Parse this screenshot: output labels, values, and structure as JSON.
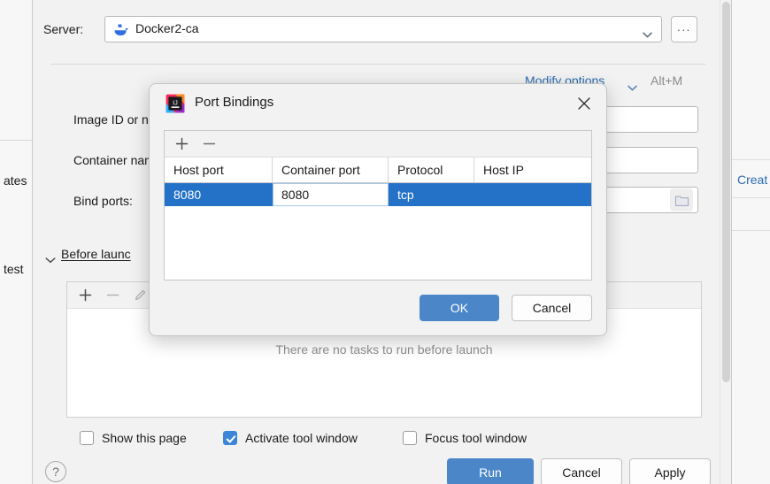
{
  "background": {
    "server_row": {
      "label": "Server:",
      "value": "Docker2-ca",
      "icon": "docker-whale-icon",
      "dropdown_icon": "chevron-down-icon",
      "more_button_label": "..."
    },
    "modify_options": {
      "link_label": "Modify options",
      "chevron_icon": "chevron-down-icon",
      "shortcut": "Alt+M"
    },
    "fields": [
      {
        "label": "Image ID or na",
        "name": "image-id-or-name"
      },
      {
        "label": "Container nam",
        "name": "container-name"
      },
      {
        "label": "Bind ports:",
        "name": "bind-ports"
      }
    ],
    "browse_icon": "folder-icon",
    "before_launch": {
      "expander_icon": "chevron-down-icon",
      "label": "Before launc",
      "toolbar": {
        "add_icon": "plus-icon",
        "remove_icon": "minus-icon",
        "edit_icon": "pencil-icon"
      },
      "empty_text": "There are no tasks to run before launch"
    },
    "checkboxes": [
      {
        "label": "Show this page",
        "checked": false,
        "name": "show-this-page"
      },
      {
        "label": "Activate tool window",
        "checked": true,
        "name": "activate-tool-window"
      },
      {
        "label": "Focus tool window",
        "checked": false,
        "name": "focus-tool-window"
      }
    ],
    "buttons": {
      "help_label": "?",
      "run_label": "Run",
      "cancel_label": "Cancel",
      "apply_label": "Apply"
    },
    "edge_left": {
      "items": [
        "ates",
        "test"
      ]
    },
    "edge_right": {
      "items": [
        "Creat"
      ]
    }
  },
  "dialog": {
    "title": "Port Bindings",
    "app_icon": "intellij-idea-icon",
    "close_icon": "close-icon",
    "toolbar": {
      "add_icon": "plus-icon",
      "remove_icon": "minus-icon"
    },
    "table": {
      "columns": [
        "Host port",
        "Container port",
        "Protocol",
        "Host IP"
      ],
      "rows": [
        {
          "host_port": "8080",
          "container_port": "8080",
          "protocol": "tcp",
          "host_ip": "",
          "selected": true,
          "editing_cell": "container_port"
        }
      ]
    },
    "ok_label": "OK",
    "cancel_label": "Cancel"
  },
  "colors": {
    "accent": "#4a86c8",
    "selection": "#2472c8",
    "link": "#2b6cb0",
    "checkbox_checked": "#3d85d8",
    "panel_bg": "#f2f2f2"
  }
}
